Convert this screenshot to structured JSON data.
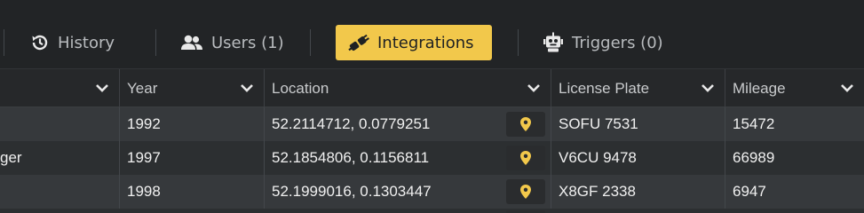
{
  "tabs": [
    {
      "label": "History",
      "icon": "history-icon",
      "active": false
    },
    {
      "label": "Users (1)",
      "icon": "users-icon",
      "active": false
    },
    {
      "label": "Integrations",
      "icon": "plug-icon",
      "active": true
    },
    {
      "label": "Triggers (0)",
      "icon": "robot-icon",
      "active": false
    }
  ],
  "table": {
    "columns": [
      {
        "label": ""
      },
      {
        "label": "Year"
      },
      {
        "label": "Location"
      },
      {
        "label": "License Plate"
      },
      {
        "label": "Mileage"
      }
    ],
    "rows": [
      {
        "name": "",
        "year": "1992",
        "location": "52.2114712, 0.0779251",
        "plate": "SOFU 7531",
        "mileage": "15472"
      },
      {
        "name": "ger",
        "year": "1997",
        "location": "52.1854806, 0.1156811",
        "plate": "V6CU 9478",
        "mileage": "66989"
      },
      {
        "name": "",
        "year": "1998",
        "location": "52.1999016, 0.1303447",
        "plate": "X8GF 2338",
        "mileage": "6947"
      }
    ]
  },
  "colors": {
    "accent": "#f2c84b",
    "background": "#1f2123",
    "header_bg": "#26282a",
    "row_alt": "#2c2f31",
    "row": "#36393c"
  }
}
